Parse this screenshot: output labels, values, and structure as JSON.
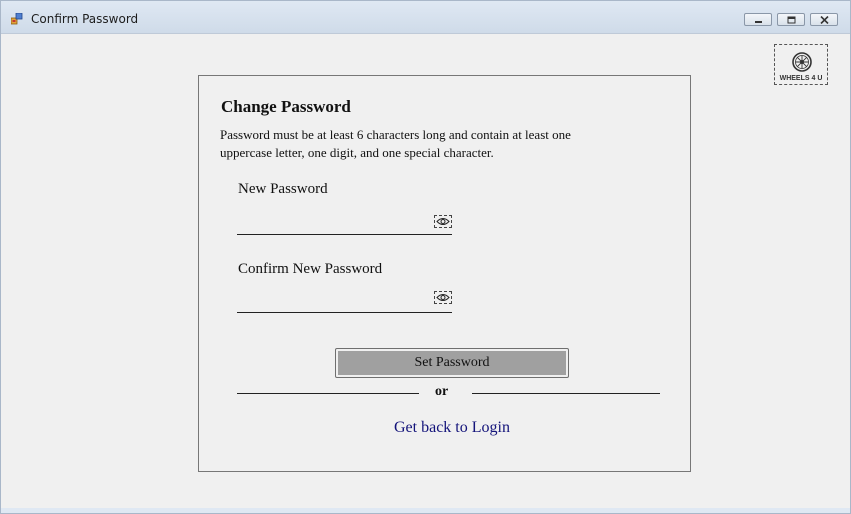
{
  "window": {
    "title": "Confirm Password",
    "controls": {
      "minimize": "minimize",
      "maximize": "maximize",
      "close": "close"
    }
  },
  "logo": {
    "text": "WHEELS 4 U",
    "icon": "wheel-icon"
  },
  "form": {
    "heading": "Change Password",
    "description": "Password must be at least 6 characters long and contain at least one uppercase letter, one digit, and one special character.",
    "new_password": {
      "label": "New Password",
      "value": "",
      "placeholder": "",
      "toggle_icon": "eye-icon"
    },
    "confirm_password": {
      "label": "Confirm New Password",
      "value": "",
      "placeholder": "",
      "toggle_icon": "eye-icon"
    },
    "submit_label": "Set Password",
    "separator_text": "or",
    "login_link": "Get back to Login"
  },
  "colors": {
    "background": "#f0f0f0",
    "button_fill": "#a0a0a0",
    "link": "#13137a"
  }
}
